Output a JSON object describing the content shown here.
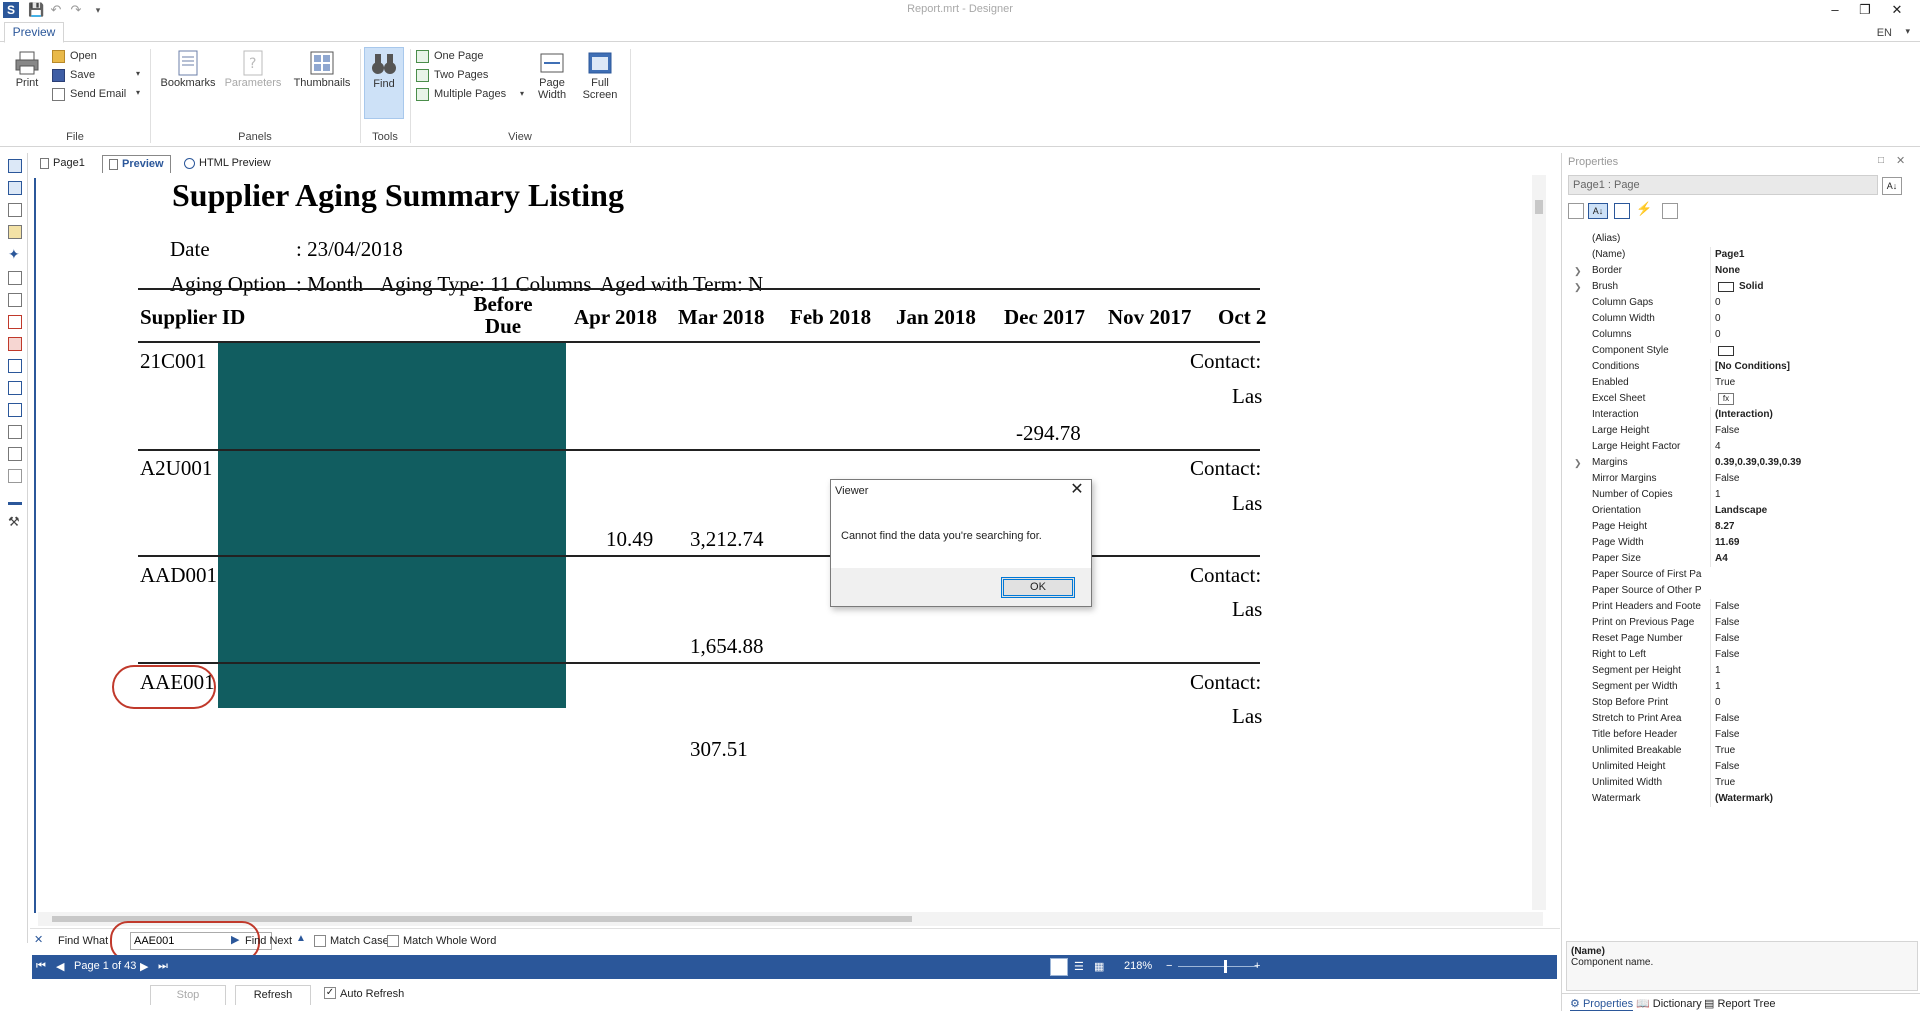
{
  "window": {
    "title": "Report.mrt - Designer",
    "minimize": "–",
    "restore": "❐",
    "close": "✕"
  },
  "ribbon": {
    "tab": "Preview",
    "lang": "EN",
    "print": "Print",
    "open": "Open",
    "save": "Save",
    "send_email": "Send Email",
    "group_file": "File",
    "bookmarks": "Bookmarks",
    "parameters": "Parameters",
    "thumbnails": "Thumbnails",
    "group_panels": "Panels",
    "find": "Find",
    "group_tools": "Tools",
    "one_page": "One Page",
    "two_pages": "Two Pages",
    "multiple_pages": "Multiple Pages",
    "page_width_1": "Page",
    "page_width_2": "Width",
    "full_screen_1": "Full",
    "full_screen_2": "Screen",
    "group_view": "View"
  },
  "preview_tabs": {
    "page1": "Page1",
    "preview": "Preview",
    "html_preview": "HTML Preview"
  },
  "report": {
    "title": "Supplier Aging Summary Listing",
    "date_label": "Date",
    "date_value": ": 23/04/2018",
    "aging_option_label": "Aging Option",
    "aging_option_value": ": Month",
    "aging_type": "Aging Type: 11 Columns",
    "aged_with_term": "Aged with Term: N",
    "columns": {
      "supplier_id": "Supplier ID",
      "before_1": "Before",
      "before_2": "Due",
      "apr": "Apr 2018",
      "mar": "Mar 2018",
      "feb": "Feb 2018",
      "jan": "Jan 2018",
      "dec": "Dec 2017",
      "nov": "Nov 2017",
      "oct": "Oct 2"
    },
    "rows": [
      {
        "id": "21C001",
        "contact": "Contact:",
        "last": "Las",
        "dec": "-294.78"
      },
      {
        "id": "A2U001",
        "contact": "Contact:",
        "last": "Las",
        "apr": "10.49",
        "mar": "3,212.74"
      },
      {
        "id": "AAD001",
        "contact": "Contact:",
        "last": "Las",
        "mar": "1,654.88"
      },
      {
        "id": "AAE001",
        "contact": "Contact:",
        "last": "Las",
        "mar": "307.51"
      }
    ]
  },
  "dialog": {
    "title": "Viewer",
    "message": "Cannot find the data you're searching for.",
    "ok": "OK"
  },
  "findbar": {
    "close": "✕",
    "find_what_label": "Find What",
    "find_value": "AAE001",
    "find_next": "Find Next",
    "match_case": "Match Case",
    "match_whole_word": "Match Whole Word"
  },
  "statusbar": {
    "page_info": "Page 1 of 43",
    "zoom": "218%",
    "zoom_minus": "−",
    "zoom_plus": "+"
  },
  "bottom": {
    "stop": "Stop",
    "refresh": "Refresh",
    "auto_refresh": "Auto Refresh"
  },
  "properties": {
    "header": "Properties",
    "selected": "Page1 : Page",
    "rows": [
      {
        "name": "(Alias)",
        "value": ""
      },
      {
        "name": "(Name)",
        "value": "Page1",
        "bold": true
      },
      {
        "name": "Border",
        "value": "None",
        "bold": true,
        "expand": true
      },
      {
        "name": "Brush",
        "value": "Solid",
        "bold": true,
        "expand": true
      },
      {
        "name": "Column Gaps",
        "value": "0"
      },
      {
        "name": "Column Width",
        "value": "0"
      },
      {
        "name": "Columns",
        "value": "0"
      },
      {
        "name": "Component Style",
        "value": ""
      },
      {
        "name": "Conditions",
        "value": "[No Conditions]",
        "bold": true
      },
      {
        "name": "Enabled",
        "value": "True"
      },
      {
        "name": "Excel Sheet",
        "value": ""
      },
      {
        "name": "Interaction",
        "value": "(Interaction)",
        "bold": true
      },
      {
        "name": "Large Height",
        "value": "False"
      },
      {
        "name": "Large Height Factor",
        "value": "4"
      },
      {
        "name": "Margins",
        "value": "0.39,0.39,0.39,0.39",
        "bold": true,
        "expand": true
      },
      {
        "name": "Mirror Margins",
        "value": "False"
      },
      {
        "name": "Number of Copies",
        "value": "1"
      },
      {
        "name": "Orientation",
        "value": "Landscape",
        "bold": true
      },
      {
        "name": "Page Height",
        "value": "8.27",
        "bold": true
      },
      {
        "name": "Page Width",
        "value": "11.69",
        "bold": true
      },
      {
        "name": "Paper Size",
        "value": "A4",
        "bold": true
      },
      {
        "name": "Paper Source of First Pa",
        "value": ""
      },
      {
        "name": "Paper Source of Other P",
        "value": ""
      },
      {
        "name": "Print Headers and Foote",
        "value": "False"
      },
      {
        "name": "Print on Previous Page",
        "value": "False"
      },
      {
        "name": "Reset Page Number",
        "value": "False"
      },
      {
        "name": "Right to Left",
        "value": "False"
      },
      {
        "name": "Segment per Height",
        "value": "1"
      },
      {
        "name": "Segment per Width",
        "value": "1"
      },
      {
        "name": "Stop Before Print",
        "value": "0"
      },
      {
        "name": "Stretch to Print Area",
        "value": "False"
      },
      {
        "name": "Title before Header",
        "value": "False"
      },
      {
        "name": "Unlimited Breakable",
        "value": "True"
      },
      {
        "name": "Unlimited Height",
        "value": "False"
      },
      {
        "name": "Unlimited Width",
        "value": "True"
      },
      {
        "name": "Watermark",
        "value": "(Watermark)",
        "bold": true
      }
    ],
    "desc_title": "(Name)",
    "desc_text": "Component name.",
    "tab_properties": "Properties",
    "tab_dictionary": "Dictionary",
    "tab_report_tree": "Report Tree"
  },
  "colors": {
    "accent": "#2b579a",
    "teal_block": "#115d60",
    "highlight_circle": "#c0392b"
  }
}
